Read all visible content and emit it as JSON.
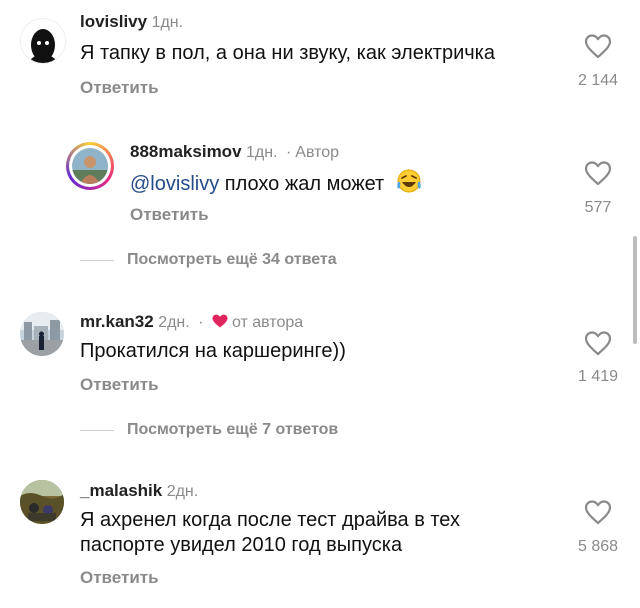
{
  "comments": [
    {
      "username": "lovislivy",
      "time": "1дн.",
      "text": "Я тапку в пол, а она ни звуку, как электричка",
      "reply_label": "Ответить",
      "likes": "2 144"
    },
    {
      "username": "888maksimov",
      "time": "1дн.",
      "author_tag": "Автор",
      "mention": "@lovislivy",
      "text": "плохо жал может",
      "emoji": "laughing-tears-emoji",
      "reply_label": "Ответить",
      "likes": "577"
    },
    {
      "username": "mr.kan32",
      "time": "2дн.",
      "liked_by_author": "от автора",
      "text": "Прокатился на каршеринге))",
      "reply_label": "Ответить",
      "likes": "1 419"
    },
    {
      "username": "_malashik",
      "time": "2дн.",
      "text_line1": "Я ахренел когда после тест драйва в тех",
      "text_line2": "паспорте увидел 2010 год выпуска",
      "reply_label": "Ответить",
      "likes": "5 868"
    }
  ],
  "view_more": [
    "Посмотреть ещё 34 ответа",
    "Посмотреть ещё 7 ответов"
  ],
  "colors": {
    "text": "#111111",
    "secondary": "#8a8a8a",
    "mention": "#244b8a",
    "author_heart": "#e0245e"
  }
}
